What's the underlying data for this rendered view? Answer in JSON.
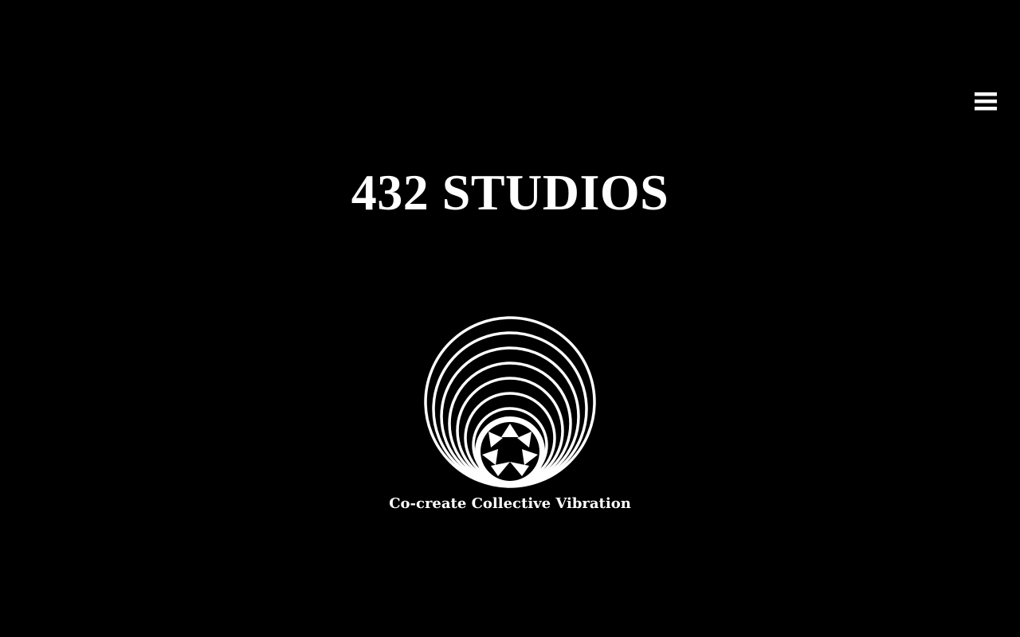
{
  "header": {
    "menu_icon": "hamburger-menu-icon"
  },
  "hero": {
    "title": "432 STUDIOS",
    "logo_icon": "concentric-circles-star-logo",
    "tagline": "Co-create Collective Vibration"
  },
  "colors": {
    "background": "#000000",
    "foreground": "#ffffff"
  }
}
